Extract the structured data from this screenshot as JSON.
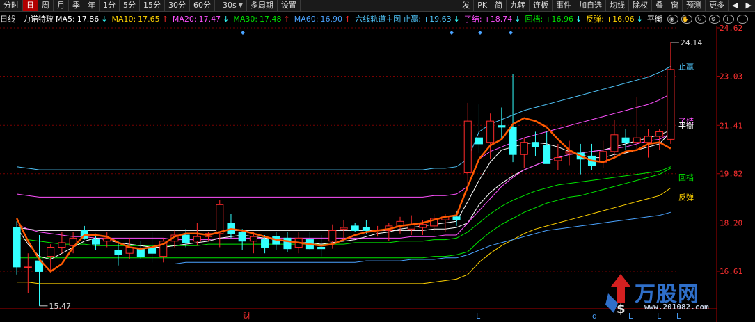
{
  "toolbar": {
    "periods": [
      "分时",
      "日",
      "周",
      "月",
      "季",
      "年",
      "1分",
      "5分",
      "15分",
      "30分",
      "60分"
    ],
    "active_period": "日",
    "custom_period": "30s",
    "multi_period": "多周期",
    "settings": "设置",
    "tools": [
      "发",
      "PK",
      "简",
      "九转",
      "连板",
      "事件"
    ],
    "actions": [
      "加自选",
      "均线",
      "除权",
      "叠",
      "窗",
      "预测",
      "更多"
    ]
  },
  "legend": {
    "period": "日线",
    "stock_name": "力诺特玻",
    "ma5": {
      "label": "MA5:",
      "value": "17.86",
      "arrow": "↓",
      "color": "#ffffff"
    },
    "ma10": {
      "label": "MA10:",
      "value": "17.65",
      "arrow": "↑",
      "color": "#ffd200"
    },
    "ma20": {
      "label": "MA20:",
      "value": "17.47",
      "arrow": "↓",
      "color": "#ff50ff"
    },
    "ma30": {
      "label": "MA30:",
      "value": "17.48",
      "arrow": "↑",
      "color": "#00e600"
    },
    "ma60": {
      "label": "MA60:",
      "value": "16.90",
      "arrow": "↑",
      "color": "#4aa3ff"
    },
    "indicator": "六线轨道主图",
    "zhiying": {
      "label": "止赢:",
      "value": "+19.63",
      "arrow": "↓",
      "color": "#4fc3f7"
    },
    "liaojie": {
      "label": "了结:",
      "value": "+18.74",
      "arrow": "↓",
      "color": "#ff50ff"
    },
    "huidang": {
      "label": "回档:",
      "value": "+16.96",
      "arrow": "↓",
      "color": "#00e600"
    },
    "fantan": {
      "label": "反弹:",
      "value": "+16.06",
      "arrow": "↓",
      "color": "#ffd200"
    },
    "pingheng": {
      "label": "平衡",
      "color": "#ffffff"
    }
  },
  "price_axis": {
    "ticks": [
      "24.62",
      "23.03",
      "21.41",
      "19.82",
      "18.20",
      "16.61"
    ]
  },
  "annotations": {
    "high_label": "24.14",
    "low_label": "15.47",
    "right_labels": {
      "zhiying": "止赢",
      "liaojie": "了结",
      "pingheng": "平衡",
      "huidang": "回档",
      "fantan": "反弹"
    },
    "bottom_markers": [
      "财",
      "L",
      "q",
      "L",
      "L",
      "L"
    ]
  },
  "watermark": {
    "brand": "万股网",
    "url": "www.201082.com"
  },
  "colors": {
    "up": "#ff2a2a",
    "down": "#33ffff",
    "bg": "#000000",
    "grid": "#7a0000",
    "axis": "#aa0000"
  },
  "chart_data": {
    "type": "candlestick",
    "ylim": [
      15.0,
      25.0
    ],
    "candles": [
      {
        "o": 18.05,
        "h": 18.25,
        "l": 16.5,
        "c": 16.75
      },
      {
        "o": 16.75,
        "h": 17.2,
        "l": 15.9,
        "c": 16.75
      },
      {
        "o": 16.95,
        "h": 17.8,
        "l": 15.47,
        "c": 16.6
      },
      {
        "o": 17.1,
        "h": 17.5,
        "l": 16.6,
        "c": 17.4
      },
      {
        "o": 17.4,
        "h": 17.9,
        "l": 17.2,
        "c": 17.55
      },
      {
        "o": 17.45,
        "h": 17.9,
        "l": 17.2,
        "c": 17.7
      },
      {
        "o": 17.95,
        "h": 18.1,
        "l": 17.65,
        "c": 17.7
      },
      {
        "o": 17.65,
        "h": 17.85,
        "l": 17.3,
        "c": 17.5
      },
      {
        "o": 17.6,
        "h": 17.9,
        "l": 17.4,
        "c": 17.7
      },
      {
        "o": 17.3,
        "h": 17.6,
        "l": 16.8,
        "c": 17.15
      },
      {
        "o": 17.2,
        "h": 17.7,
        "l": 17.0,
        "c": 17.4
      },
      {
        "o": 17.35,
        "h": 17.6,
        "l": 17.0,
        "c": 17.1
      },
      {
        "o": 17.4,
        "h": 17.9,
        "l": 16.9,
        "c": 17.2
      },
      {
        "o": 17.1,
        "h": 17.7,
        "l": 16.9,
        "c": 17.6
      },
      {
        "o": 17.6,
        "h": 17.95,
        "l": 17.4,
        "c": 17.8
      },
      {
        "o": 17.8,
        "h": 18.0,
        "l": 17.4,
        "c": 17.55
      },
      {
        "o": 17.6,
        "h": 18.2,
        "l": 17.45,
        "c": 17.75
      },
      {
        "o": 17.75,
        "h": 17.9,
        "l": 17.6,
        "c": 17.85
      },
      {
        "o": 17.85,
        "h": 18.95,
        "l": 17.4,
        "c": 18.8
      },
      {
        "o": 18.2,
        "h": 18.5,
        "l": 17.7,
        "c": 17.85
      },
      {
        "o": 17.9,
        "h": 18.0,
        "l": 17.3,
        "c": 17.6
      },
      {
        "o": 17.6,
        "h": 17.9,
        "l": 17.2,
        "c": 17.75
      },
      {
        "o": 17.65,
        "h": 17.8,
        "l": 17.2,
        "c": 17.4
      },
      {
        "o": 17.75,
        "h": 17.9,
        "l": 17.3,
        "c": 17.5
      },
      {
        "o": 17.7,
        "h": 17.9,
        "l": 17.25,
        "c": 17.35
      },
      {
        "o": 17.4,
        "h": 17.9,
        "l": 17.2,
        "c": 17.7
      },
      {
        "o": 17.65,
        "h": 17.9,
        "l": 17.3,
        "c": 17.35
      },
      {
        "o": 17.4,
        "h": 17.8,
        "l": 17.1,
        "c": 17.35
      },
      {
        "o": 17.6,
        "h": 18.15,
        "l": 17.35,
        "c": 17.95
      },
      {
        "o": 18.0,
        "h": 18.3,
        "l": 17.6,
        "c": 18.05
      },
      {
        "o": 18.1,
        "h": 18.2,
        "l": 17.9,
        "c": 17.95
      },
      {
        "o": 18.05,
        "h": 18.3,
        "l": 17.85,
        "c": 17.95
      },
      {
        "o": 17.9,
        "h": 18.1,
        "l": 17.75,
        "c": 17.95
      },
      {
        "o": 17.95,
        "h": 18.2,
        "l": 17.6,
        "c": 18.1
      },
      {
        "o": 18.1,
        "h": 18.4,
        "l": 17.85,
        "c": 18.25
      },
      {
        "o": 18.0,
        "h": 18.45,
        "l": 17.8,
        "c": 18.15
      },
      {
        "o": 18.05,
        "h": 18.3,
        "l": 17.8,
        "c": 18.15
      },
      {
        "o": 18.1,
        "h": 18.5,
        "l": 17.9,
        "c": 18.35
      },
      {
        "o": 18.3,
        "h": 18.5,
        "l": 17.9,
        "c": 18.4
      },
      {
        "o": 18.4,
        "h": 18.6,
        "l": 18.1,
        "c": 18.3
      },
      {
        "o": 19.85,
        "h": 22.15,
        "l": 19.25,
        "c": 21.55
      },
      {
        "o": 21.0,
        "h": 22.1,
        "l": 20.5,
        "c": 20.8
      },
      {
        "o": 20.85,
        "h": 21.8,
        "l": 20.3,
        "c": 21.55
      },
      {
        "o": 21.4,
        "h": 22.0,
        "l": 21.0,
        "c": 21.35
      },
      {
        "o": 21.35,
        "h": 23.1,
        "l": 20.2,
        "c": 20.45
      },
      {
        "o": 20.45,
        "h": 21.0,
        "l": 20.0,
        "c": 20.85
      },
      {
        "o": 20.85,
        "h": 21.2,
        "l": 20.4,
        "c": 20.7
      },
      {
        "o": 20.75,
        "h": 21.2,
        "l": 20.2,
        "c": 20.15
      },
      {
        "o": 20.25,
        "h": 20.8,
        "l": 19.95,
        "c": 20.35
      },
      {
        "o": 20.5,
        "h": 20.9,
        "l": 20.1,
        "c": 20.55
      },
      {
        "o": 20.5,
        "h": 20.8,
        "l": 19.8,
        "c": 20.3
      },
      {
        "o": 20.4,
        "h": 20.8,
        "l": 19.95,
        "c": 20.1
      },
      {
        "o": 20.2,
        "h": 20.9,
        "l": 20.0,
        "c": 20.55
      },
      {
        "o": 20.55,
        "h": 21.6,
        "l": 20.3,
        "c": 21.1
      },
      {
        "o": 21.0,
        "h": 21.3,
        "l": 20.6,
        "c": 20.85
      },
      {
        "o": 20.85,
        "h": 22.35,
        "l": 20.6,
        "c": 21.0
      },
      {
        "o": 20.85,
        "h": 21.3,
        "l": 20.35,
        "c": 21.05
      },
      {
        "o": 21.05,
        "h": 21.3,
        "l": 20.6,
        "c": 21.2
      },
      {
        "o": 20.95,
        "h": 24.14,
        "l": 20.8,
        "c": 23.25
      }
    ],
    "ma_white": [
      18.05,
      17.5,
      17.1,
      17.0,
      17.2,
      17.4,
      17.6,
      17.7,
      17.65,
      17.55,
      17.5,
      17.45,
      17.4,
      17.4,
      17.45,
      17.5,
      17.55,
      17.6,
      17.7,
      17.75,
      17.8,
      17.75,
      17.7,
      17.65,
      17.6,
      17.55,
      17.55,
      17.5,
      17.55,
      17.6,
      17.65,
      17.75,
      17.85,
      17.9,
      18.0,
      18.05,
      18.1,
      18.15,
      18.2,
      18.25,
      18.9,
      19.6,
      20.2,
      20.6,
      20.7,
      20.8,
      20.85,
      20.8,
      20.7,
      20.55,
      20.45,
      20.35,
      20.35,
      20.45,
      20.5,
      20.6,
      20.7,
      20.8,
      21.2
    ],
    "thick_orange": [
      18.35,
      17.6,
      17.0,
      16.6,
      16.85,
      17.4,
      17.8,
      17.8,
      17.75,
      17.55,
      17.4,
      17.35,
      17.4,
      17.5,
      17.75,
      17.85,
      17.85,
      17.8,
      17.9,
      18.0,
      17.95,
      17.85,
      17.75,
      17.65,
      17.6,
      17.55,
      17.5,
      17.45,
      17.5,
      17.65,
      17.8,
      17.9,
      17.95,
      18.0,
      18.1,
      18.15,
      18.2,
      18.3,
      18.4,
      18.45,
      19.4,
      20.3,
      20.75,
      20.95,
      21.45,
      21.65,
      21.55,
      21.35,
      20.95,
      20.6,
      20.4,
      20.25,
      20.2,
      20.35,
      20.55,
      20.6,
      20.8,
      20.85,
      20.65
    ],
    "bands": {
      "zhiying": [
        20.05,
        20.0,
        19.95,
        19.95,
        19.95,
        19.95,
        19.95,
        19.95,
        19.95,
        19.95,
        19.95,
        19.95,
        19.95,
        19.95,
        19.95,
        19.95,
        19.95,
        19.95,
        19.95,
        19.95,
        19.95,
        19.95,
        19.95,
        19.95,
        19.95,
        19.95,
        19.95,
        19.95,
        19.95,
        19.95,
        19.95,
        19.95,
        19.95,
        19.95,
        19.95,
        19.95,
        19.95,
        20.0,
        20.0,
        20.05,
        20.3,
        21.2,
        21.45,
        21.6,
        21.75,
        21.9,
        22.0,
        22.1,
        22.2,
        22.3,
        22.4,
        22.5,
        22.6,
        22.7,
        22.8,
        22.9,
        23.0,
        23.15,
        23.35
      ],
      "liaojie": [
        19.15,
        19.1,
        19.05,
        19.05,
        19.05,
        19.05,
        19.05,
        19.05,
        19.05,
        19.05,
        19.05,
        19.05,
        19.05,
        19.05,
        19.05,
        19.05,
        19.05,
        19.05,
        19.05,
        19.05,
        19.05,
        19.05,
        19.05,
        19.05,
        19.05,
        19.05,
        19.05,
        19.05,
        19.05,
        19.05,
        19.05,
        19.05,
        19.05,
        19.05,
        19.05,
        19.05,
        19.05,
        19.1,
        19.1,
        19.15,
        19.4,
        20.3,
        20.55,
        20.7,
        20.85,
        21.0,
        21.1,
        21.2,
        21.3,
        21.4,
        21.5,
        21.6,
        21.7,
        21.8,
        21.9,
        22.0,
        22.1,
        22.25,
        22.45
      ],
      "pingheng": [
        18.05,
        18.0,
        17.95,
        17.95,
        17.95,
        17.95,
        17.95,
        17.95,
        17.95,
        17.95,
        17.95,
        17.95,
        17.95,
        17.95,
        17.95,
        17.95,
        17.95,
        17.95,
        17.95,
        17.95,
        17.95,
        17.95,
        17.95,
        17.95,
        17.95,
        17.95,
        17.95,
        17.95,
        17.95,
        17.95,
        17.95,
        17.95,
        17.95,
        17.95,
        17.95,
        17.95,
        17.95,
        18.0,
        18.0,
        18.05,
        18.2,
        18.8,
        19.2,
        19.5,
        19.75,
        19.95,
        20.1,
        20.25,
        20.35,
        20.45,
        20.5,
        20.55,
        20.6,
        20.7,
        20.8,
        20.9,
        21.0,
        21.1,
        21.25
      ],
      "huidang": [
        17.05,
        17.05,
        17.05,
        17.05,
        17.05,
        17.05,
        17.05,
        17.05,
        17.05,
        17.05,
        17.05,
        17.05,
        17.05,
        17.05,
        17.05,
        17.05,
        17.05,
        17.05,
        17.05,
        17.05,
        17.05,
        17.05,
        17.05,
        17.05,
        17.05,
        17.05,
        17.05,
        17.05,
        17.05,
        17.05,
        17.05,
        17.05,
        17.05,
        17.05,
        17.05,
        17.05,
        17.05,
        17.1,
        17.1,
        17.15,
        17.25,
        17.6,
        17.9,
        18.15,
        18.35,
        18.55,
        18.7,
        18.85,
        18.95,
        19.05,
        19.1,
        19.2,
        19.3,
        19.4,
        19.5,
        19.6,
        19.7,
        19.8,
        20.0
      ],
      "fantan": [
        16.25,
        16.25,
        16.2,
        16.2,
        16.2,
        16.2,
        16.2,
        16.2,
        16.2,
        16.2,
        16.2,
        16.2,
        16.2,
        16.2,
        16.2,
        16.2,
        16.2,
        16.2,
        16.2,
        16.2,
        16.2,
        16.2,
        16.2,
        16.2,
        16.2,
        16.2,
        16.2,
        16.2,
        16.2,
        16.2,
        16.2,
        16.2,
        16.2,
        16.2,
        16.2,
        16.2,
        16.2,
        16.25,
        16.3,
        16.35,
        16.5,
        16.9,
        17.2,
        17.45,
        17.65,
        17.85,
        18.0,
        18.1,
        18.2,
        18.3,
        18.4,
        18.5,
        18.6,
        18.7,
        18.8,
        18.9,
        19.0,
        19.1,
        19.35
      ]
    },
    "ma_lines": {
      "ma20_pink": [
        18.15,
        18.0,
        17.9,
        17.85,
        17.8,
        17.75,
        17.75,
        17.7,
        17.7,
        17.7,
        17.7,
        17.7,
        17.7,
        17.7,
        17.65,
        17.65,
        17.65,
        17.65,
        17.7,
        17.7,
        17.7,
        17.7,
        17.7,
        17.7,
        17.7,
        17.7,
        17.7,
        17.7,
        17.7,
        17.7,
        17.7,
        17.7,
        17.7,
        17.7,
        17.7,
        17.75,
        17.75,
        17.75,
        17.8,
        17.8,
        18.2,
        18.6,
        19.0,
        19.4,
        19.7,
        19.95,
        20.1,
        20.25,
        20.35,
        20.45,
        20.5,
        20.55,
        20.6,
        20.65,
        20.7,
        20.8,
        20.9,
        20.95,
        21.15
      ],
      "ma30_green": [
        17.7,
        17.65,
        17.6,
        17.55,
        17.5,
        17.5,
        17.5,
        17.45,
        17.45,
        17.45,
        17.45,
        17.45,
        17.45,
        17.45,
        17.45,
        17.45,
        17.45,
        17.5,
        17.5,
        17.5,
        17.5,
        17.5,
        17.5,
        17.5,
        17.5,
        17.5,
        17.5,
        17.5,
        17.5,
        17.5,
        17.55,
        17.55,
        17.55,
        17.55,
        17.6,
        17.6,
        17.6,
        17.65,
        17.65,
        17.7,
        17.9,
        18.2,
        18.5,
        18.75,
        18.95,
        19.1,
        19.25,
        19.35,
        19.45,
        19.5,
        19.55,
        19.6,
        19.65,
        19.7,
        19.75,
        19.8,
        19.85,
        19.9,
        20.05
      ],
      "ma60_blue": [
        16.85,
        16.85,
        16.85,
        16.85,
        16.85,
        16.85,
        16.85,
        16.85,
        16.85,
        16.85,
        16.85,
        16.85,
        16.85,
        16.85,
        16.85,
        16.9,
        16.9,
        16.9,
        16.9,
        16.9,
        16.9,
        16.9,
        16.9,
        16.9,
        16.9,
        16.9,
        16.9,
        16.9,
        16.9,
        16.9,
        16.9,
        16.95,
        16.95,
        16.95,
        16.95,
        17.0,
        17.0,
        17.0,
        17.05,
        17.05,
        17.15,
        17.3,
        17.45,
        17.55,
        17.65,
        17.75,
        17.85,
        17.95,
        18.0,
        18.05,
        18.1,
        18.15,
        18.2,
        18.25,
        18.3,
        18.35,
        18.4,
        18.45,
        18.55
      ]
    }
  }
}
